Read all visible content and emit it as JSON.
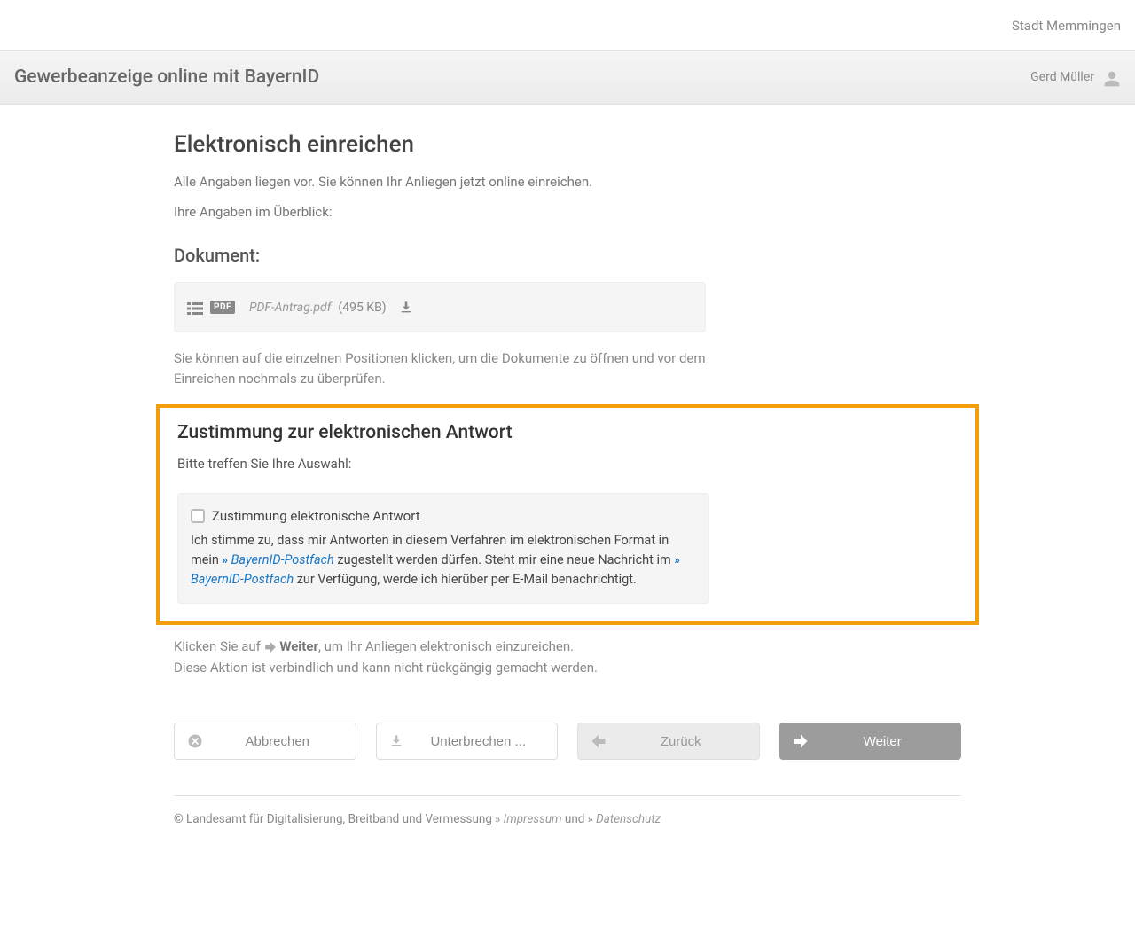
{
  "top": {
    "city": "Stadt Memmingen"
  },
  "header": {
    "title": "Gewerbeanzeige online mit BayernID",
    "user": "Gerd Müller"
  },
  "main": {
    "heading": "Elektronisch einreichen",
    "subtitle": "Alle Angaben liegen vor. Sie können Ihr Anliegen jetzt online einreichen.",
    "overview_label": "Ihre Angaben im Überblick:",
    "document_heading": "Dokument:",
    "document": {
      "badge": "PDF",
      "name": "PDF-Antrag.pdf",
      "size": "(495 KB)"
    },
    "doc_hint": "Sie können auf die einzelnen Positionen klicken, um die Dokumente zu öffnen und vor dem Einreichen nochmals zu überprüfen.",
    "consent": {
      "heading": "Zustimmung zur elektronischen Antwort",
      "prompt": "Bitte treffen Sie Ihre Auswahl:",
      "checkbox_label": "Zustimmung elektronische Antwort",
      "text_before": "Ich stimme zu, dass mir Antworten in diesem Verfahren im elektronischen Format in mein ",
      "link": "BayernID-Postfach",
      "text_mid": " zugestellt werden dürfen. Steht mir eine neue Nachricht im ",
      "link2": "BayernID-Postfach",
      "text_after": " zur Verfügung, werde ich hierüber per E-Mail benachrichtigt."
    },
    "submit_hint": {
      "line1_before": "Klicken Sie auf ",
      "line1_bold": "Weiter",
      "line1_after": ", um Ihr Anliegen elektronisch einzureichen.",
      "line2": "Diese Aktion ist verbindlich und kann nicht rückgängig gemacht werden."
    },
    "buttons": {
      "cancel": "Abbrechen",
      "pause": "Unterbrechen ...",
      "back": "Zurück",
      "next": "Weiter"
    }
  },
  "footer": {
    "copyright": "© Landesamt für Digitalisierung, Breitband und Vermessung ",
    "impressum": "Impressum",
    "and": " und ",
    "privacy": "Datenschutz"
  }
}
